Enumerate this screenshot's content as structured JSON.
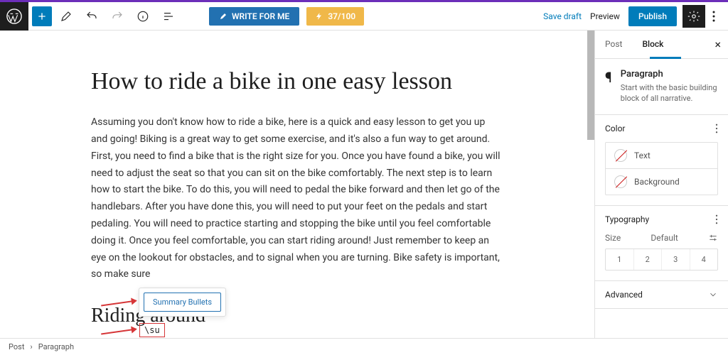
{
  "toolbar": {
    "write_label": "WRITE FOR ME",
    "credits_label": "37/100",
    "save_label": "Save draft",
    "preview_label": "Preview",
    "publish_label": "Publish"
  },
  "post": {
    "title": "How to ride a bike in one easy lesson",
    "body": "Assuming you don't know how to ride a bike, here is a quick and easy lesson to get you up and going! Biking is a great way to get some exercise, and it's also a fun way to get around. First, you need to find a bike that is the right size for you. Once you have found a bike, you will need to adjust the seat so that you can sit on the bike comfortably. The next step is to learn how to start the bike. To do this, you will need to pedal the bike forward and then let go of the handlebars. After you have done this, you will need to put your feet on the pedals and start pedaling. You will need to practice starting and stopping the bike until you feel comfortable doing it. Once you feel comfortable, you can start riding around! Just remember to keep an eye on the lookout for obstacles, and to signal when you are turning. Bike safety is important, so make sure",
    "h2": "Riding around",
    "shortcode": "\\su"
  },
  "popup": {
    "item": "Summary Bullets"
  },
  "sidebar": {
    "tabs": {
      "post": "Post",
      "block": "Block"
    },
    "block": {
      "name": "Paragraph",
      "desc": "Start with the basic building block of all narrative."
    },
    "panels": {
      "color": "Color",
      "color_text": "Text",
      "color_bg": "Background",
      "typography": "Typography",
      "size_label": "Size",
      "size_default": "Default",
      "sizes": [
        "1",
        "2",
        "3",
        "4"
      ],
      "advanced": "Advanced"
    }
  },
  "breadcrumb": {
    "root": "Post",
    "current": "Paragraph"
  }
}
